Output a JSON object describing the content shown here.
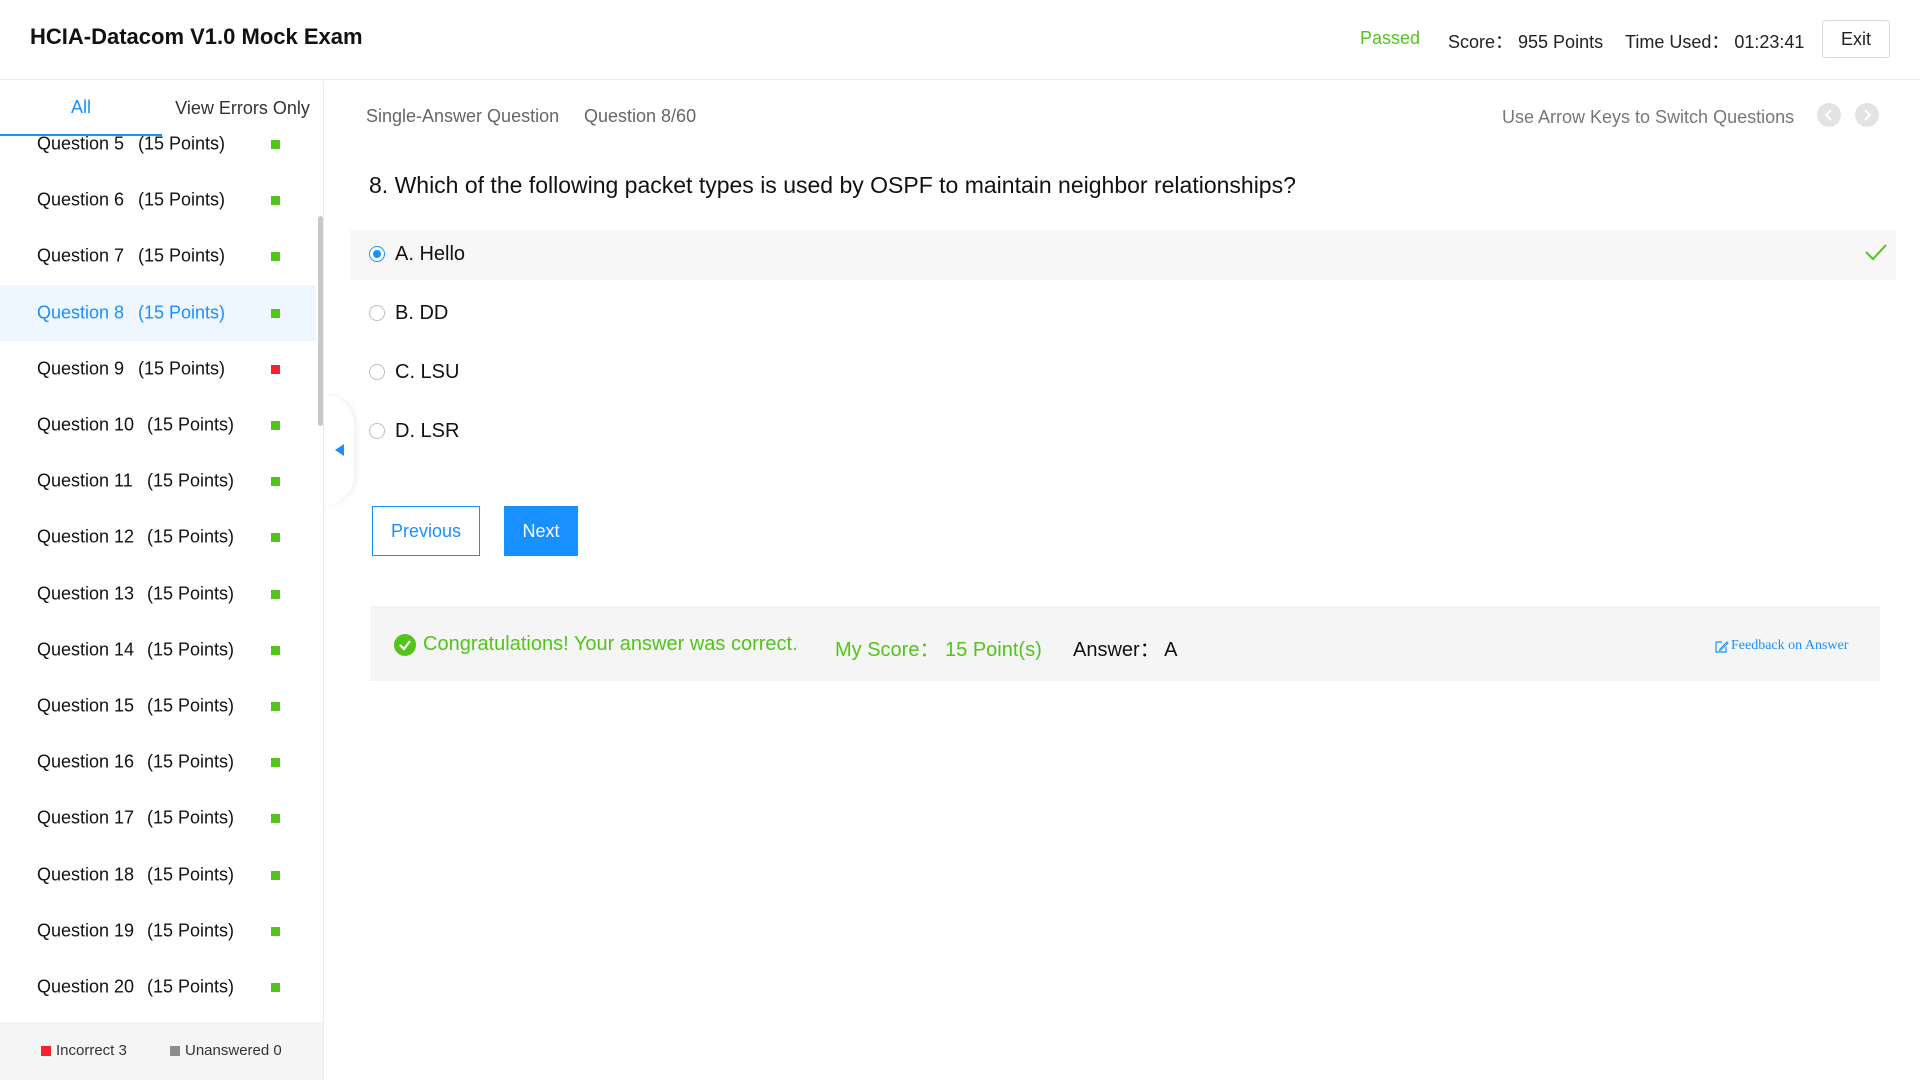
{
  "header": {
    "title": "HCIA-Datacom V1.0 Mock Exam",
    "status": "Passed",
    "score": "Score： 955 Points",
    "time_used": "Time Used： 01:23:41",
    "exit_label": "Exit"
  },
  "sidebar": {
    "tabs": [
      {
        "label": "All",
        "active": true
      },
      {
        "label": "View Errors Only",
        "active": false
      }
    ],
    "questions": [
      {
        "name": "Question 5",
        "points": "(15 Points)",
        "status": "correct"
      },
      {
        "name": "Question 6",
        "points": "(15 Points)",
        "status": "correct"
      },
      {
        "name": "Question 7",
        "points": "(15 Points)",
        "status": "correct"
      },
      {
        "name": "Question 8",
        "points": "(15 Points)",
        "status": "correct",
        "active": true
      },
      {
        "name": "Question 9",
        "points": "(15 Points)",
        "status": "incorrect"
      },
      {
        "name": "Question 10",
        "points": "(15 Points)",
        "status": "correct"
      },
      {
        "name": "Question 11",
        "points": "(15 Points)",
        "status": "correct"
      },
      {
        "name": "Question 12",
        "points": "(15 Points)",
        "status": "correct"
      },
      {
        "name": "Question 13",
        "points": "(15 Points)",
        "status": "correct"
      },
      {
        "name": "Question 14",
        "points": "(15 Points)",
        "status": "correct"
      },
      {
        "name": "Question 15",
        "points": "(15 Points)",
        "status": "correct"
      },
      {
        "name": "Question 16",
        "points": "(15 Points)",
        "status": "correct"
      },
      {
        "name": "Question 17",
        "points": "(15 Points)",
        "status": "correct"
      },
      {
        "name": "Question 18",
        "points": "(15 Points)",
        "status": "correct"
      },
      {
        "name": "Question 19",
        "points": "(15 Points)",
        "status": "correct"
      },
      {
        "name": "Question 20",
        "points": "(15 Points)",
        "status": "correct"
      }
    ],
    "legend": {
      "incorrect": "Incorrect 3",
      "unanswered": "Unanswered 0"
    }
  },
  "main": {
    "question_type": "Single-Answer Question",
    "question_counter": "Question 8/60",
    "arrow_hint": "Use Arrow Keys to Switch Questions",
    "question_text": "8. Which of the following packet types is used by OSPF to maintain neighbor relationships?",
    "options": [
      {
        "label": "A. Hello",
        "selected": true,
        "correct": true
      },
      {
        "label": "B. DD",
        "selected": false,
        "correct": false
      },
      {
        "label": "C. LSU",
        "selected": false,
        "correct": false
      },
      {
        "label": "D. LSR",
        "selected": false,
        "correct": false
      }
    ],
    "previous_label": "Previous",
    "next_label": "Next",
    "result": {
      "message": "Congratulations! Your answer was correct.",
      "my_score": "My Score： 15 Point(s)",
      "answer": "Answer： A",
      "feedback_label": "Feedback on Answer"
    }
  },
  "colors": {
    "accent": "#1890ff",
    "correct": "#52c41a",
    "incorrect": "#f5222d",
    "unanswered": "#8c8c8c"
  }
}
